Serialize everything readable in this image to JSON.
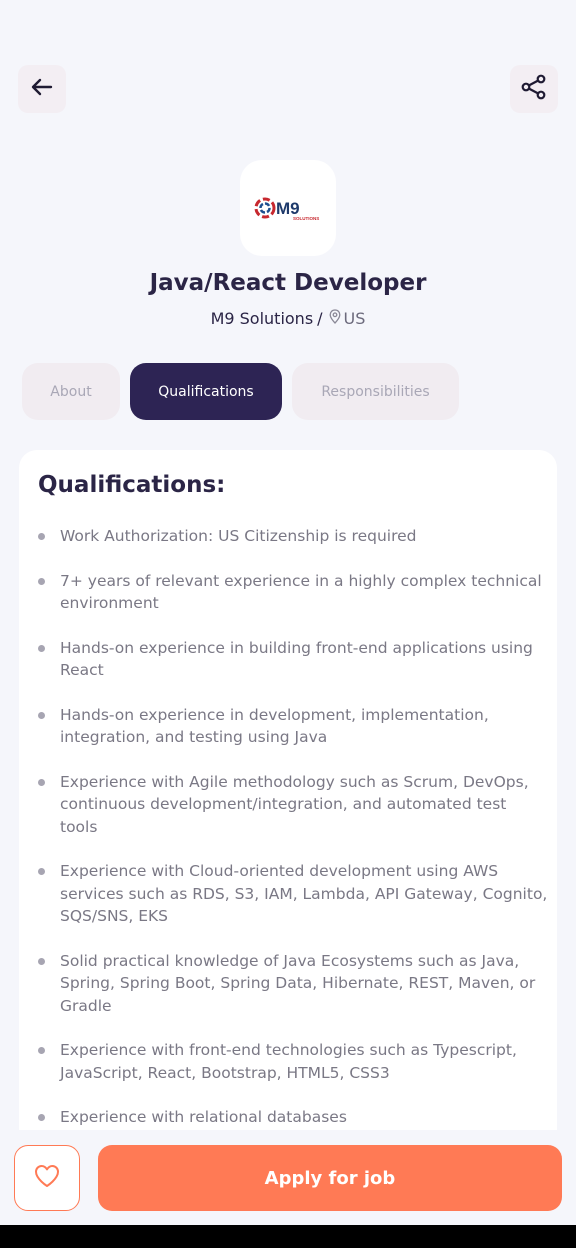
{
  "header": {
    "back_icon": "arrow-left-icon",
    "share_icon": "share-icon"
  },
  "company": {
    "logo_text": "M9",
    "logo_subtext": "SOLUTIONS",
    "name": "M9 Solutions",
    "separator": "/",
    "location": "US"
  },
  "job": {
    "title": "Java/React Developer"
  },
  "tabs": [
    {
      "label": "About",
      "active": false
    },
    {
      "label": "Qualifications",
      "active": true
    },
    {
      "label": "Responsibilities",
      "active": false
    }
  ],
  "qualifications": {
    "heading": "Qualifications:",
    "items": [
      "Work Authorization: US Citizenship is required",
      "7+ years of relevant experience in a highly complex technical environment",
      "Hands-on experience in building front-end applications using React",
      "Hands-on experience in development, implementation, integration, and testing using Java",
      "Experience with Agile methodology such as Scrum, DevOps, continuous development/integration, and automated test tools",
      "Experience with Cloud-oriented development using AWS services such as RDS, S3, IAM, Lambda, API Gateway, Cognito, SQS/SNS, EKS",
      "Solid practical knowledge of Java Ecosystems such as Java, Spring, Spring Boot, Spring Data, Hibernate, REST, Maven, or Gradle",
      "Experience with front-end technologies such as Typescript, JavaScript, React, Bootstrap, HTML5, CSS3",
      "Experience with relational databases"
    ]
  },
  "actions": {
    "favorite_icon": "heart-icon",
    "apply_label": "Apply for job"
  },
  "colors": {
    "accent": "#ff7a55",
    "primary_dark": "#2d2454",
    "background": "#f5f6fb"
  }
}
